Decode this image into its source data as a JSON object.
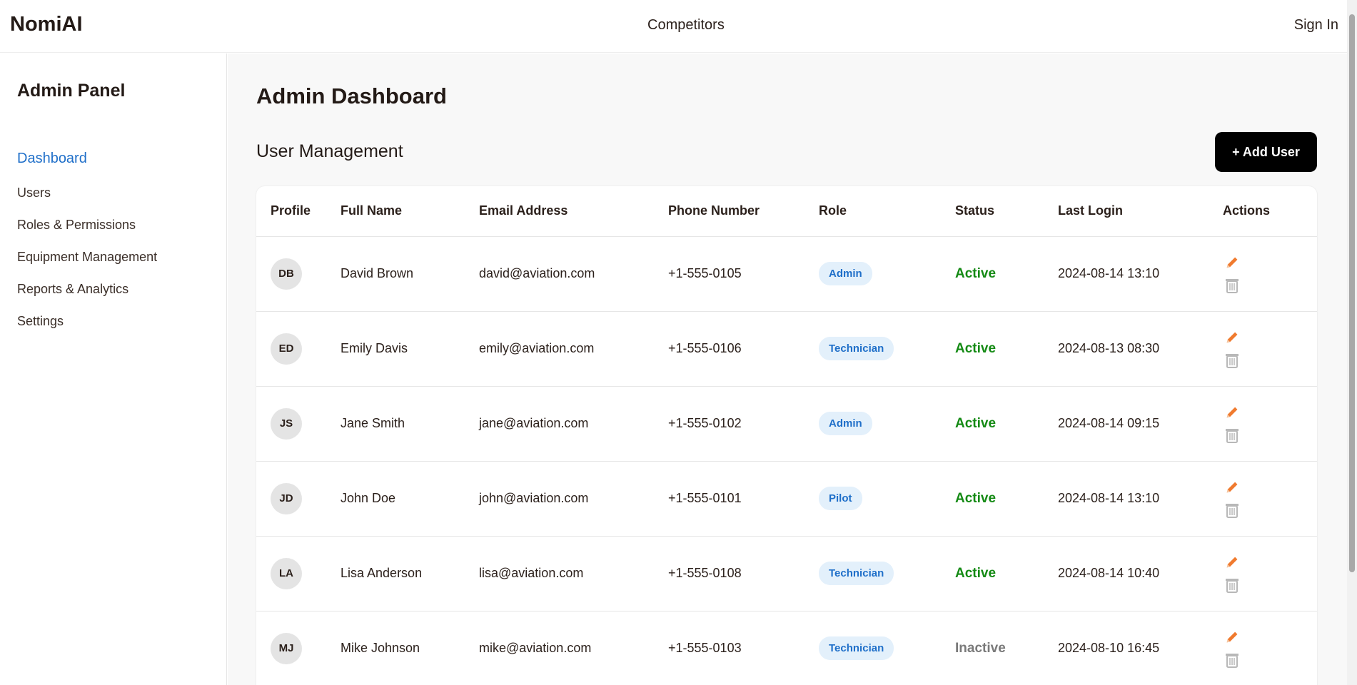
{
  "header": {
    "brand": "NomiAI",
    "nav_competitors": "Competitors",
    "sign_in": "Sign In"
  },
  "sidebar": {
    "title": "Admin Panel",
    "items": [
      {
        "label": "Dashboard",
        "active": true
      },
      {
        "label": "Users"
      },
      {
        "label": "Roles & Permissions"
      },
      {
        "label": "Equipment Management"
      },
      {
        "label": "Reports & Analytics"
      },
      {
        "label": "Settings"
      }
    ]
  },
  "main": {
    "page_title": "Admin Dashboard",
    "section_title": "User Management",
    "add_user_label": "+ Add User",
    "columns": [
      "Profile",
      "Full Name",
      "Email Address",
      "Phone Number",
      "Role",
      "Status",
      "Last Login",
      "Actions"
    ],
    "rows": [
      {
        "initials": "DB",
        "name": "David Brown",
        "email": "david@aviation.com",
        "phone": "+1-555-0105",
        "role": "Admin",
        "status": "Active",
        "last_login": "2024-08-14 13:10"
      },
      {
        "initials": "ED",
        "name": "Emily Davis",
        "email": "emily@aviation.com",
        "phone": "+1-555-0106",
        "role": "Technician",
        "status": "Active",
        "last_login": "2024-08-13 08:30"
      },
      {
        "initials": "JS",
        "name": "Jane Smith",
        "email": "jane@aviation.com",
        "phone": "+1-555-0102",
        "role": "Admin",
        "status": "Active",
        "last_login": "2024-08-14 09:15"
      },
      {
        "initials": "JD",
        "name": "John Doe",
        "email": "john@aviation.com",
        "phone": "+1-555-0101",
        "role": "Pilot",
        "status": "Active",
        "last_login": "2024-08-14 13:10"
      },
      {
        "initials": "LA",
        "name": "Lisa Anderson",
        "email": "lisa@aviation.com",
        "phone": "+1-555-0108",
        "role": "Technician",
        "status": "Active",
        "last_login": "2024-08-14 10:40"
      },
      {
        "initials": "MJ",
        "name": "Mike Johnson",
        "email": "mike@aviation.com",
        "phone": "+1-555-0103",
        "role": "Technician",
        "status": "Inactive",
        "last_login": "2024-08-10 16:45"
      }
    ]
  },
  "colors": {
    "accent": "#1f6fc9",
    "active_status": "#148a14",
    "inactive_status": "#7a7a7a",
    "edit_icon": "#f07a2e",
    "delete_icon": "#b8b8b8"
  },
  "icons": {
    "edit": "pencil-icon",
    "delete": "trash-icon"
  }
}
